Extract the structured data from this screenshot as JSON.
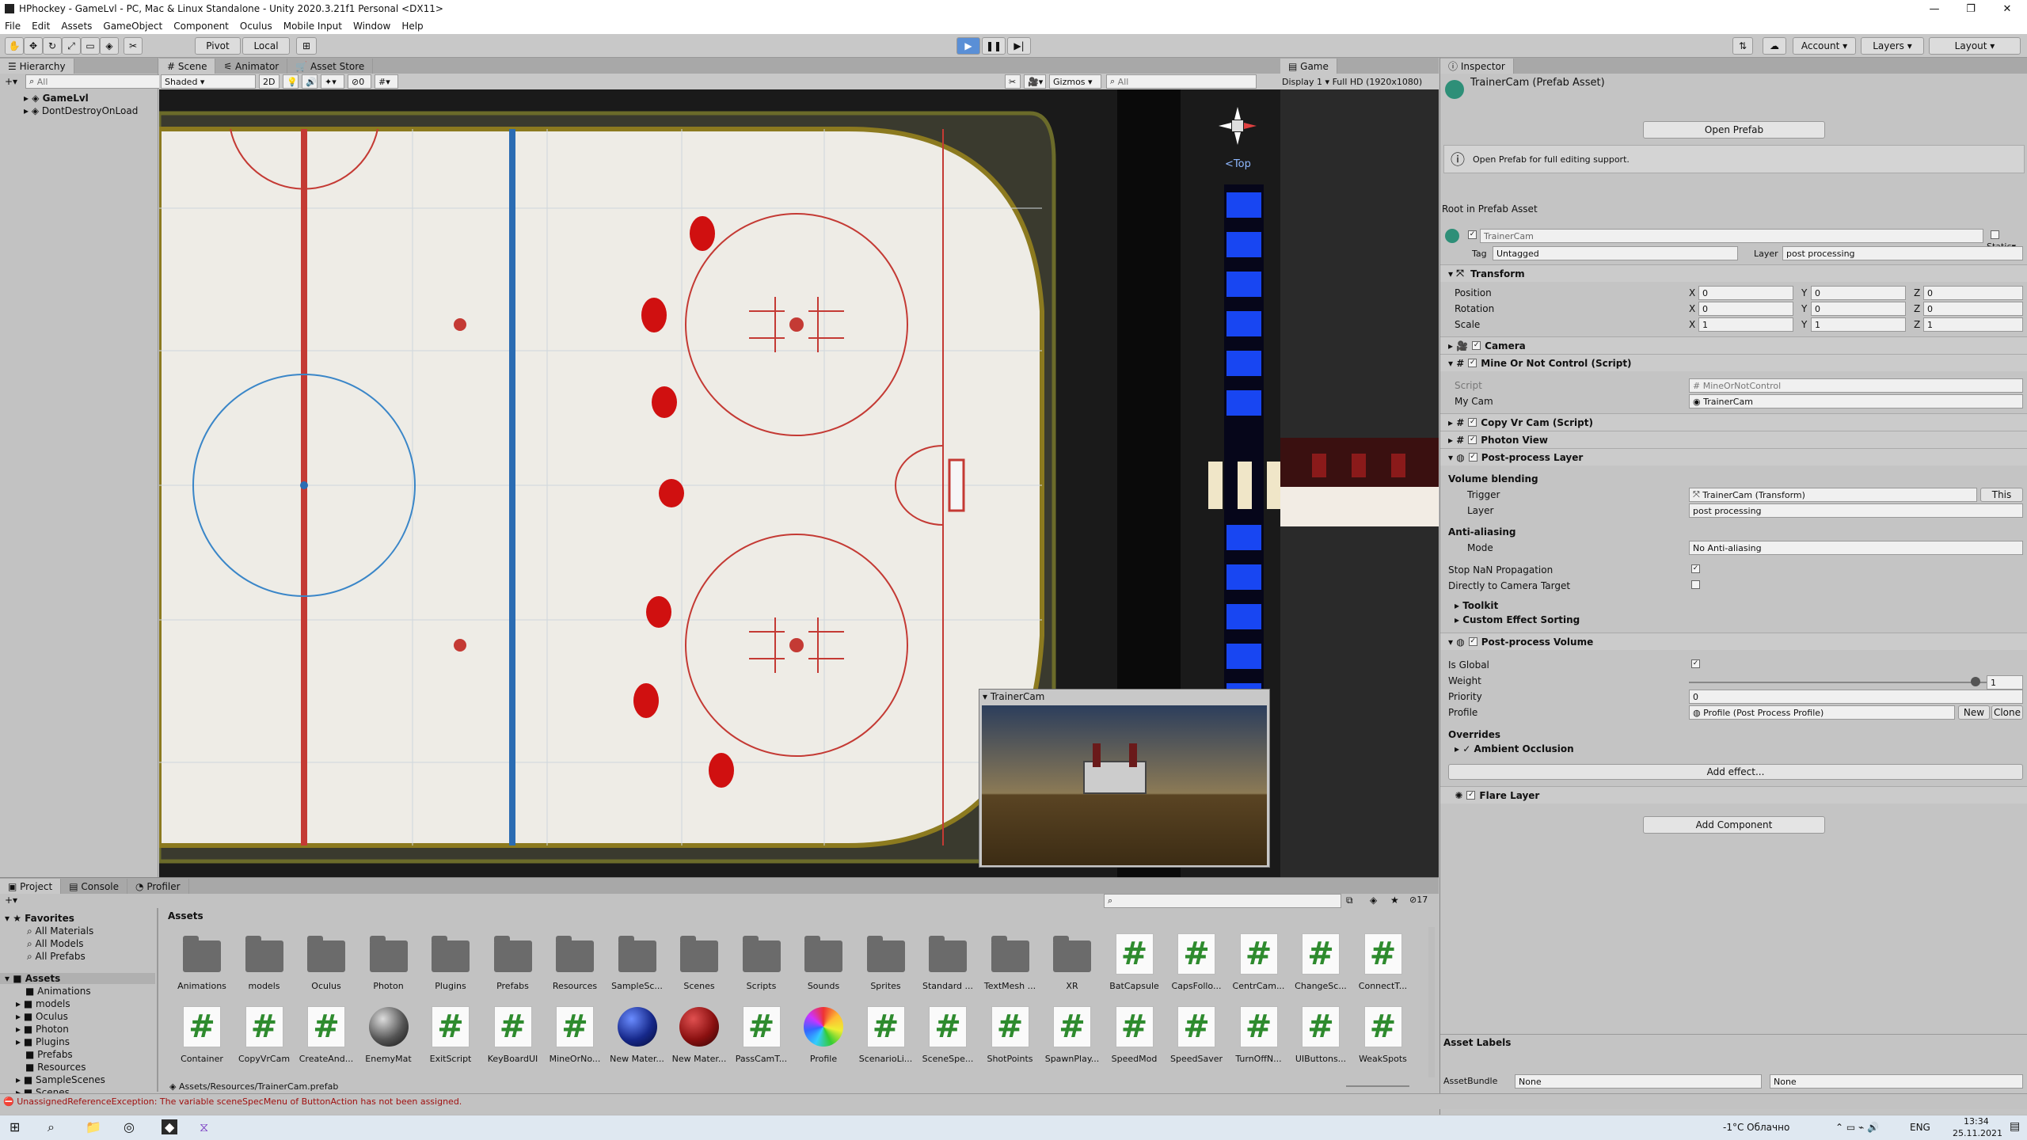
{
  "window": {
    "title": "HPhockey - GameLvl - PC, Mac & Linux Standalone - Unity 2020.3.21f1 Personal <DX11>"
  },
  "menu": [
    "File",
    "Edit",
    "Assets",
    "GameObject",
    "Component",
    "Oculus",
    "Mobile Input",
    "Window",
    "Help"
  ],
  "toolbar": {
    "pivot": "Pivot",
    "local": "Local",
    "account": "Account",
    "layers": "Layers",
    "layout": "Layout"
  },
  "hierarchy": {
    "tab": "Hierarchy",
    "search": "All",
    "items": [
      "GameLvl",
      "DontDestroyOnLoad"
    ]
  },
  "scene": {
    "tabs": [
      "Scene",
      "Animator",
      "Asset Store"
    ],
    "shading": "Shaded",
    "mode2d": "2D",
    "gizmos": "Gizmos",
    "search": "All",
    "gizmo_label": "<Top",
    "count": "0"
  },
  "game": {
    "tab": "Game",
    "display": "Display 1",
    "resolution": "Full HD (1920x1080)"
  },
  "trainercam": {
    "title": "TrainerCam"
  },
  "inspector": {
    "tab": "Inspector",
    "asset_name": "TrainerCam (Prefab Asset)",
    "open_prefab": "Open Prefab",
    "info": "Open Prefab for full editing support.",
    "root_label": "Root in Prefab Asset",
    "object_name": "TrainerCam",
    "static": "Static",
    "tag_label": "Tag",
    "tag": "Untagged",
    "layer_label": "Layer",
    "layer": "post processing",
    "transform": {
      "title": "Transform",
      "rows": [
        {
          "label": "Position",
          "x": "0",
          "y": "0",
          "z": "0"
        },
        {
          "label": "Rotation",
          "x": "0",
          "y": "0",
          "z": "0"
        },
        {
          "label": "Scale",
          "x": "1",
          "y": "1",
          "z": "1"
        }
      ]
    },
    "camera": "Camera",
    "mine": {
      "title": "Mine Or Not Control (Script)",
      "script_label": "Script",
      "script": "MineOrNotControl",
      "mycam_label": "My Cam",
      "mycam": "TrainerCam"
    },
    "copyvr": "Copy Vr Cam (Script)",
    "photon": "Photon View",
    "pplayer": {
      "title": "Post-process Layer",
      "volume_blending": "Volume blending",
      "trigger_label": "Trigger",
      "trigger": "TrainerCam (Transform)",
      "this": "This",
      "layer_label": "Layer",
      "layer": "post processing",
      "aa": "Anti-aliasing",
      "mode_label": "Mode",
      "mode": "No Anti-aliasing",
      "stopnan": "Stop NaN Propagation",
      "direct": "Directly to Camera Target",
      "toolkit": "Toolkit",
      "custom": "Custom Effect Sorting"
    },
    "ppvolume": {
      "title": "Post-process Volume",
      "global": "Is Global",
      "weight_label": "Weight",
      "weight": "1",
      "priority_label": "Priority",
      "priority": "0",
      "profile_label": "Profile",
      "profile": "Profile (Post Process Profile)",
      "new": "New",
      "clone": "Clone",
      "overrides": "Overrides",
      "ao": "Ambient Occlusion",
      "add_effect": "Add effect..."
    },
    "flare": "Flare Layer",
    "add_component": "Add Component",
    "asset_labels": "Asset Labels",
    "bundle_label": "AssetBundle",
    "bundle": "None",
    "bundle2": "None"
  },
  "project": {
    "tabs": [
      "Project",
      "Console",
      "Profiler"
    ],
    "favorites": "Favorites",
    "fav_items": [
      "All Materials",
      "All Models",
      "All Prefabs"
    ],
    "assets": "Assets",
    "tree": [
      "Animations",
      "models",
      "Oculus",
      "Photon",
      "Plugins",
      "Prefabs",
      "Resources",
      "SampleScenes",
      "Scenes"
    ],
    "breadcrumb": "Assets",
    "count": "17",
    "path": "Assets/Resources/TrainerCam.prefab",
    "row1": [
      {
        "n": "Animations",
        "t": "folder"
      },
      {
        "n": "models",
        "t": "folder"
      },
      {
        "n": "Oculus",
        "t": "folder"
      },
      {
        "n": "Photon",
        "t": "folder"
      },
      {
        "n": "Plugins",
        "t": "folder"
      },
      {
        "n": "Prefabs",
        "t": "folder"
      },
      {
        "n": "Resources",
        "t": "folder"
      },
      {
        "n": "SampleSc...",
        "t": "folder"
      },
      {
        "n": "Scenes",
        "t": "folder"
      },
      {
        "n": "Scripts",
        "t": "folder"
      },
      {
        "n": "Sounds",
        "t": "folder"
      },
      {
        "n": "Sprites",
        "t": "folder"
      },
      {
        "n": "Standard ...",
        "t": "folder"
      },
      {
        "n": "TextMesh ...",
        "t": "folder"
      },
      {
        "n": "XR",
        "t": "folder"
      },
      {
        "n": "BatCapsule",
        "t": "script"
      },
      {
        "n": "CapsFollo...",
        "t": "script"
      },
      {
        "n": "CentrCam...",
        "t": "script"
      },
      {
        "n": "ChangeSc...",
        "t": "script"
      },
      {
        "n": "ConnectT...",
        "t": "script"
      }
    ],
    "row2": [
      {
        "n": "Container",
        "t": "script"
      },
      {
        "n": "CopyVrCam",
        "t": "script"
      },
      {
        "n": "CreateAnd...",
        "t": "script"
      },
      {
        "n": "EnemyMat",
        "t": "mat-gray"
      },
      {
        "n": "ExitScript",
        "t": "script"
      },
      {
        "n": "KeyBoardUI",
        "t": "script"
      },
      {
        "n": "MineOrNo...",
        "t": "script"
      },
      {
        "n": "New Mater...",
        "t": "mat-blue"
      },
      {
        "n": "New Mater...",
        "t": "mat-red"
      },
      {
        "n": "PassCamT...",
        "t": "script"
      },
      {
        "n": "Profile",
        "t": "profile"
      },
      {
        "n": "ScenarioLi...",
        "t": "script"
      },
      {
        "n": "SceneSpe...",
        "t": "script"
      },
      {
        "n": "ShotPoints",
        "t": "script"
      },
      {
        "n": "SpawnPlay...",
        "t": "script"
      },
      {
        "n": "SpeedMod",
        "t": "script"
      },
      {
        "n": "SpeedSaver",
        "t": "script"
      },
      {
        "n": "TurnOffN...",
        "t": "script"
      },
      {
        "n": "UIButtons...",
        "t": "script"
      },
      {
        "n": "WeakSpots",
        "t": "script"
      }
    ]
  },
  "status": {
    "error": "UnassignedReferenceException: The variable sceneSpecMenu of ButtonAction has not been assigned."
  },
  "taskbar": {
    "weather": "-1°C  Облачно",
    "lang": "ENG",
    "time": "13:34",
    "date": "25.11.2021"
  }
}
